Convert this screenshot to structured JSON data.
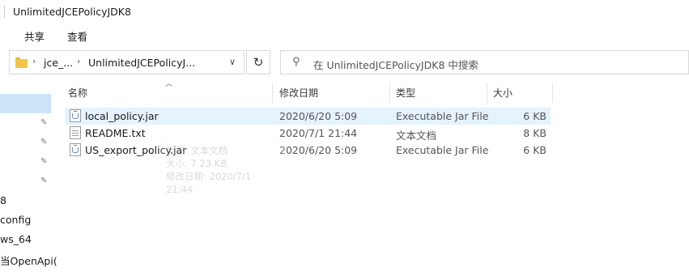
{
  "window": {
    "title": "UnlimitedJCEPolicyJDK8"
  },
  "ribbon": {
    "tab_partial": "亻",
    "tab_share": "共享",
    "tab_view": "查看"
  },
  "address": {
    "crumb1": "jce_...",
    "crumb2": "UnlimitedJCEPolicyJ...",
    "separator": "›",
    "dropdown_icon": "chevron-down",
    "refresh_glyph": "↻"
  },
  "search": {
    "placeholder": "在 UnlimitedJCEPolicyJDK8 中搜索",
    "icon": "search"
  },
  "nav": {
    "pin_glyph": "📌",
    "items": [
      "8",
      "config",
      "ws_64",
      "当OpenApi("
    ]
  },
  "columns": {
    "name": "名称",
    "date": "修改日期",
    "type": "类型",
    "size": "大小"
  },
  "files": [
    {
      "name": "local_policy.jar",
      "date": "2020/6/20 5:09",
      "type": "Executable Jar File",
      "size": "6 KB",
      "icon": "jar-file"
    },
    {
      "name": "README.txt",
      "date": "2020/7/1 21:44",
      "type": "文本文档",
      "size": "8 KB",
      "icon": "text-file"
    },
    {
      "name": "US_export_policy.jar",
      "date": "2020/6/20 5:09",
      "type": "Executable Jar File",
      "size": "6 KB",
      "icon": "jar-file"
    }
  ],
  "tooltip": {
    "line1": "类型: 文本文档",
    "line2": "大小: 7.23 KB",
    "line3": "修改日期: 2020/7/1 21:44"
  },
  "colors": {
    "selection": "#cce4f7",
    "hover_row": "#e5f3ff",
    "folder": "#f3c44a"
  }
}
